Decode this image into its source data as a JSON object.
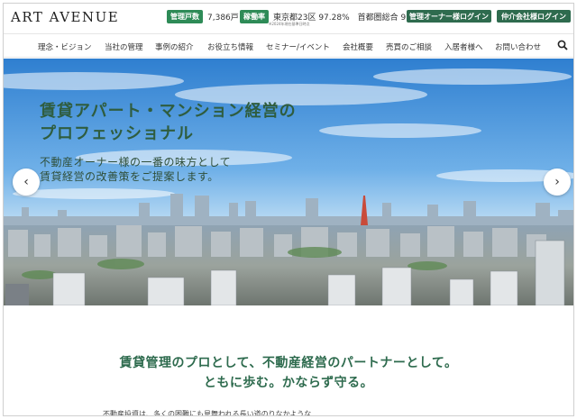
{
  "header": {
    "logo": "ART AVENUE",
    "stats": [
      {
        "label": "管理戸数",
        "value": "7,386戸"
      },
      {
        "label": "稼働率",
        "value": "東京都23区 97.28%　首都圏総合 97.2%"
      }
    ],
    "stats_note": "※2024年現在基準日時点",
    "owner_login": "管理オーナー様ログイン",
    "broker_login": "仲介会社様ログイン"
  },
  "nav": {
    "items": [
      "理念・ビジョン",
      "当社の管理",
      "事例の紹介",
      "お役立ち情報",
      "セミナー/イベント",
      "会社概要",
      "売買のご相談",
      "入居者様へ",
      "お問い合わせ"
    ]
  },
  "hero": {
    "title_line1": "賃貸アパート・マンション経営の",
    "title_line2": "プロフェッショナル",
    "sub_line1": "不動産オーナー様の一番の味方として",
    "sub_line2": "賃貸経営の改善策をご提案します。",
    "prev": "‹",
    "next": "›"
  },
  "tagline": {
    "line1": "賃貸管理のプロとして、不動産経営のパートナーとして。",
    "line2": "ともに歩む。かならず守る。"
  },
  "body_text": "不動産投資は、多くの困難にも見舞われる長い道のりなかような",
  "colors": {
    "accent": "#2e6b4e",
    "badge": "#2e8b57",
    "title": "#2f5d3f"
  }
}
